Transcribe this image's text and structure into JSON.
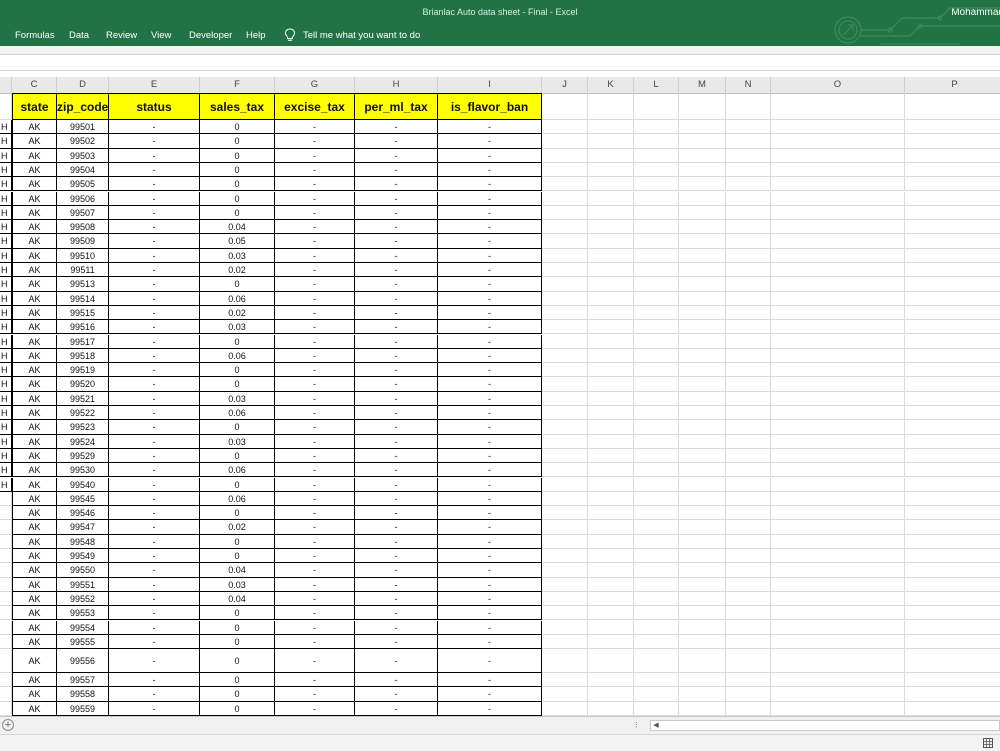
{
  "window": {
    "title": "Brianlac Auto data sheet - Final  -  Excel",
    "user": "Mohammad"
  },
  "ribbon": {
    "tabs": [
      {
        "label": "Formulas"
      },
      {
        "label": "Data"
      },
      {
        "label": "Review"
      },
      {
        "label": "View"
      },
      {
        "label": "Developer"
      },
      {
        "label": "Help"
      }
    ],
    "tell_me": "Tell me what you want to do"
  },
  "sheet": {
    "column_letters": [
      "C",
      "D",
      "E",
      "F",
      "G",
      "H",
      "I",
      "J",
      "K",
      "L",
      "M",
      "N",
      "O",
      "P"
    ],
    "headers": [
      "state",
      "zip_code",
      "status",
      "sales_tax",
      "excise_tax",
      "per_ml_tax",
      "is_flavor_ban"
    ],
    "cutoff_column_value": "H",
    "rows": [
      {
        "b": "H",
        "state": "AK",
        "zip": "99501",
        "status": "-",
        "sales_tax": "0",
        "excise_tax": "-",
        "per_ml_tax": "-",
        "flavor_ban": "-"
      },
      {
        "b": "H",
        "state": "AK",
        "zip": "99502",
        "status": "-",
        "sales_tax": "0",
        "excise_tax": "-",
        "per_ml_tax": "-",
        "flavor_ban": "-"
      },
      {
        "b": "H",
        "state": "AK",
        "zip": "99503",
        "status": "-",
        "sales_tax": "0",
        "excise_tax": "-",
        "per_ml_tax": "-",
        "flavor_ban": "-"
      },
      {
        "b": "H",
        "state": "AK",
        "zip": "99504",
        "status": "-",
        "sales_tax": "0",
        "excise_tax": "-",
        "per_ml_tax": "-",
        "flavor_ban": "-"
      },
      {
        "b": "H",
        "state": "AK",
        "zip": "99505",
        "status": "-",
        "sales_tax": "0",
        "excise_tax": "-",
        "per_ml_tax": "-",
        "flavor_ban": "-"
      },
      {
        "b": "H",
        "state": "AK",
        "zip": "99506",
        "status": "-",
        "sales_tax": "0",
        "excise_tax": "-",
        "per_ml_tax": "-",
        "flavor_ban": "-"
      },
      {
        "b": "H",
        "state": "AK",
        "zip": "99507",
        "status": "-",
        "sales_tax": "0",
        "excise_tax": "-",
        "per_ml_tax": "-",
        "flavor_ban": "-"
      },
      {
        "b": "H",
        "state": "AK",
        "zip": "99508",
        "status": "-",
        "sales_tax": "0.04",
        "excise_tax": "-",
        "per_ml_tax": "-",
        "flavor_ban": "-"
      },
      {
        "b": "H",
        "state": "AK",
        "zip": "99509",
        "status": "-",
        "sales_tax": "0.05",
        "excise_tax": "-",
        "per_ml_tax": "-",
        "flavor_ban": "-"
      },
      {
        "b": "H",
        "state": "AK",
        "zip": "99510",
        "status": "-",
        "sales_tax": "0.03",
        "excise_tax": "-",
        "per_ml_tax": "-",
        "flavor_ban": "-"
      },
      {
        "b": "H",
        "state": "AK",
        "zip": "99511",
        "status": "-",
        "sales_tax": "0.02",
        "excise_tax": "-",
        "per_ml_tax": "-",
        "flavor_ban": "-"
      },
      {
        "b": "H",
        "state": "AK",
        "zip": "99513",
        "status": "-",
        "sales_tax": "0",
        "excise_tax": "-",
        "per_ml_tax": "-",
        "flavor_ban": "-"
      },
      {
        "b": "H",
        "state": "AK",
        "zip": "99514",
        "status": "-",
        "sales_tax": "0.06",
        "excise_tax": "-",
        "per_ml_tax": "-",
        "flavor_ban": "-"
      },
      {
        "b": "H",
        "state": "AK",
        "zip": "99515",
        "status": "-",
        "sales_tax": "0.02",
        "excise_tax": "-",
        "per_ml_tax": "-",
        "flavor_ban": "-"
      },
      {
        "b": "H",
        "state": "AK",
        "zip": "99516",
        "status": "-",
        "sales_tax": "0.03",
        "excise_tax": "-",
        "per_ml_tax": "-",
        "flavor_ban": "-"
      },
      {
        "b": "H",
        "state": "AK",
        "zip": "99517",
        "status": "-",
        "sales_tax": "0",
        "excise_tax": "-",
        "per_ml_tax": "-",
        "flavor_ban": "-"
      },
      {
        "b": "H",
        "state": "AK",
        "zip": "99518",
        "status": "-",
        "sales_tax": "0.06",
        "excise_tax": "-",
        "per_ml_tax": "-",
        "flavor_ban": "-"
      },
      {
        "b": "H",
        "state": "AK",
        "zip": "99519",
        "status": "-",
        "sales_tax": "0",
        "excise_tax": "-",
        "per_ml_tax": "-",
        "flavor_ban": "-"
      },
      {
        "b": "H",
        "state": "AK",
        "zip": "99520",
        "status": "-",
        "sales_tax": "0",
        "excise_tax": "-",
        "per_ml_tax": "-",
        "flavor_ban": "-"
      },
      {
        "b": "H",
        "state": "AK",
        "zip": "99521",
        "status": "-",
        "sales_tax": "0.03",
        "excise_tax": "-",
        "per_ml_tax": "-",
        "flavor_ban": "-"
      },
      {
        "b": "H",
        "state": "AK",
        "zip": "99522",
        "status": "-",
        "sales_tax": "0.06",
        "excise_tax": "-",
        "per_ml_tax": "-",
        "flavor_ban": "-"
      },
      {
        "b": "H",
        "state": "AK",
        "zip": "99523",
        "status": "-",
        "sales_tax": "0",
        "excise_tax": "-",
        "per_ml_tax": "-",
        "flavor_ban": "-"
      },
      {
        "b": "H",
        "state": "AK",
        "zip": "99524",
        "status": "-",
        "sales_tax": "0.03",
        "excise_tax": "-",
        "per_ml_tax": "-",
        "flavor_ban": "-"
      },
      {
        "b": "H",
        "state": "AK",
        "zip": "99529",
        "status": "-",
        "sales_tax": "0",
        "excise_tax": "-",
        "per_ml_tax": "-",
        "flavor_ban": "-"
      },
      {
        "b": "H",
        "state": "AK",
        "zip": "99530",
        "status": "-",
        "sales_tax": "0.06",
        "excise_tax": "-",
        "per_ml_tax": "-",
        "flavor_ban": "-"
      },
      {
        "b": "H",
        "state": "AK",
        "zip": "99540",
        "status": "-",
        "sales_tax": "0",
        "excise_tax": "-",
        "per_ml_tax": "-",
        "flavor_ban": "-"
      },
      {
        "b": "",
        "state": "AK",
        "zip": "99545",
        "status": "-",
        "sales_tax": "0.06",
        "excise_tax": "-",
        "per_ml_tax": "-",
        "flavor_ban": "-"
      },
      {
        "b": "",
        "state": "AK",
        "zip": "99546",
        "status": "-",
        "sales_tax": "0",
        "excise_tax": "-",
        "per_ml_tax": "-",
        "flavor_ban": "-"
      },
      {
        "b": "",
        "state": "AK",
        "zip": "99547",
        "status": "-",
        "sales_tax": "0.02",
        "excise_tax": "-",
        "per_ml_tax": "-",
        "flavor_ban": "-"
      },
      {
        "b": "",
        "state": "AK",
        "zip": "99548",
        "status": "-",
        "sales_tax": "0",
        "excise_tax": "-",
        "per_ml_tax": "-",
        "flavor_ban": "-"
      },
      {
        "b": "",
        "state": "AK",
        "zip": "99549",
        "status": "-",
        "sales_tax": "0",
        "excise_tax": "-",
        "per_ml_tax": "-",
        "flavor_ban": "-"
      },
      {
        "b": "",
        "state": "AK",
        "zip": "99550",
        "status": "-",
        "sales_tax": "0.04",
        "excise_tax": "-",
        "per_ml_tax": "-",
        "flavor_ban": "-"
      },
      {
        "b": "",
        "state": "AK",
        "zip": "99551",
        "status": "-",
        "sales_tax": "0.03",
        "excise_tax": "-",
        "per_ml_tax": "-",
        "flavor_ban": "-"
      },
      {
        "b": "",
        "state": "AK",
        "zip": "99552",
        "status": "-",
        "sales_tax": "0.04",
        "excise_tax": "-",
        "per_ml_tax": "-",
        "flavor_ban": "-"
      },
      {
        "b": "",
        "state": "AK",
        "zip": "99553",
        "status": "-",
        "sales_tax": "0",
        "excise_tax": "-",
        "per_ml_tax": "-",
        "flavor_ban": "-"
      },
      {
        "b": "",
        "state": "AK",
        "zip": "99554",
        "status": "-",
        "sales_tax": "0",
        "excise_tax": "-",
        "per_ml_tax": "-",
        "flavor_ban": "-"
      },
      {
        "b": "",
        "state": "AK",
        "zip": "99555",
        "status": "-",
        "sales_tax": "0",
        "excise_tax": "-",
        "per_ml_tax": "-",
        "flavor_ban": "-"
      },
      {
        "b": "",
        "state": "AK",
        "zip": "99556",
        "status": "-",
        "sales_tax": "0",
        "excise_tax": "-",
        "per_ml_tax": "-",
        "flavor_ban": "-"
      },
      {
        "b": "",
        "state": "AK",
        "zip": "99557",
        "status": "-",
        "sales_tax": "0",
        "excise_tax": "-",
        "per_ml_tax": "-",
        "flavor_ban": "-"
      },
      {
        "b": "",
        "state": "AK",
        "zip": "99558",
        "status": "-",
        "sales_tax": "0",
        "excise_tax": "-",
        "per_ml_tax": "-",
        "flavor_ban": "-"
      },
      {
        "b": "",
        "state": "AK",
        "zip": "99559",
        "status": "-",
        "sales_tax": "0",
        "excise_tax": "-",
        "per_ml_tax": "-",
        "flavor_ban": "-"
      }
    ]
  },
  "colors": {
    "excel_green": "#217346",
    "header_fill": "#ffff00"
  },
  "icons": {
    "tell_me": "lightbulb-icon",
    "add_sheet": "plus-circle-icon",
    "scroll_left": "triangle-left-icon",
    "view_normal": "grid-view-icon"
  },
  "sheetbar": {
    "add_glyph": "+",
    "split_glyph": "⁝",
    "scroll_left_glyph": "◀"
  }
}
